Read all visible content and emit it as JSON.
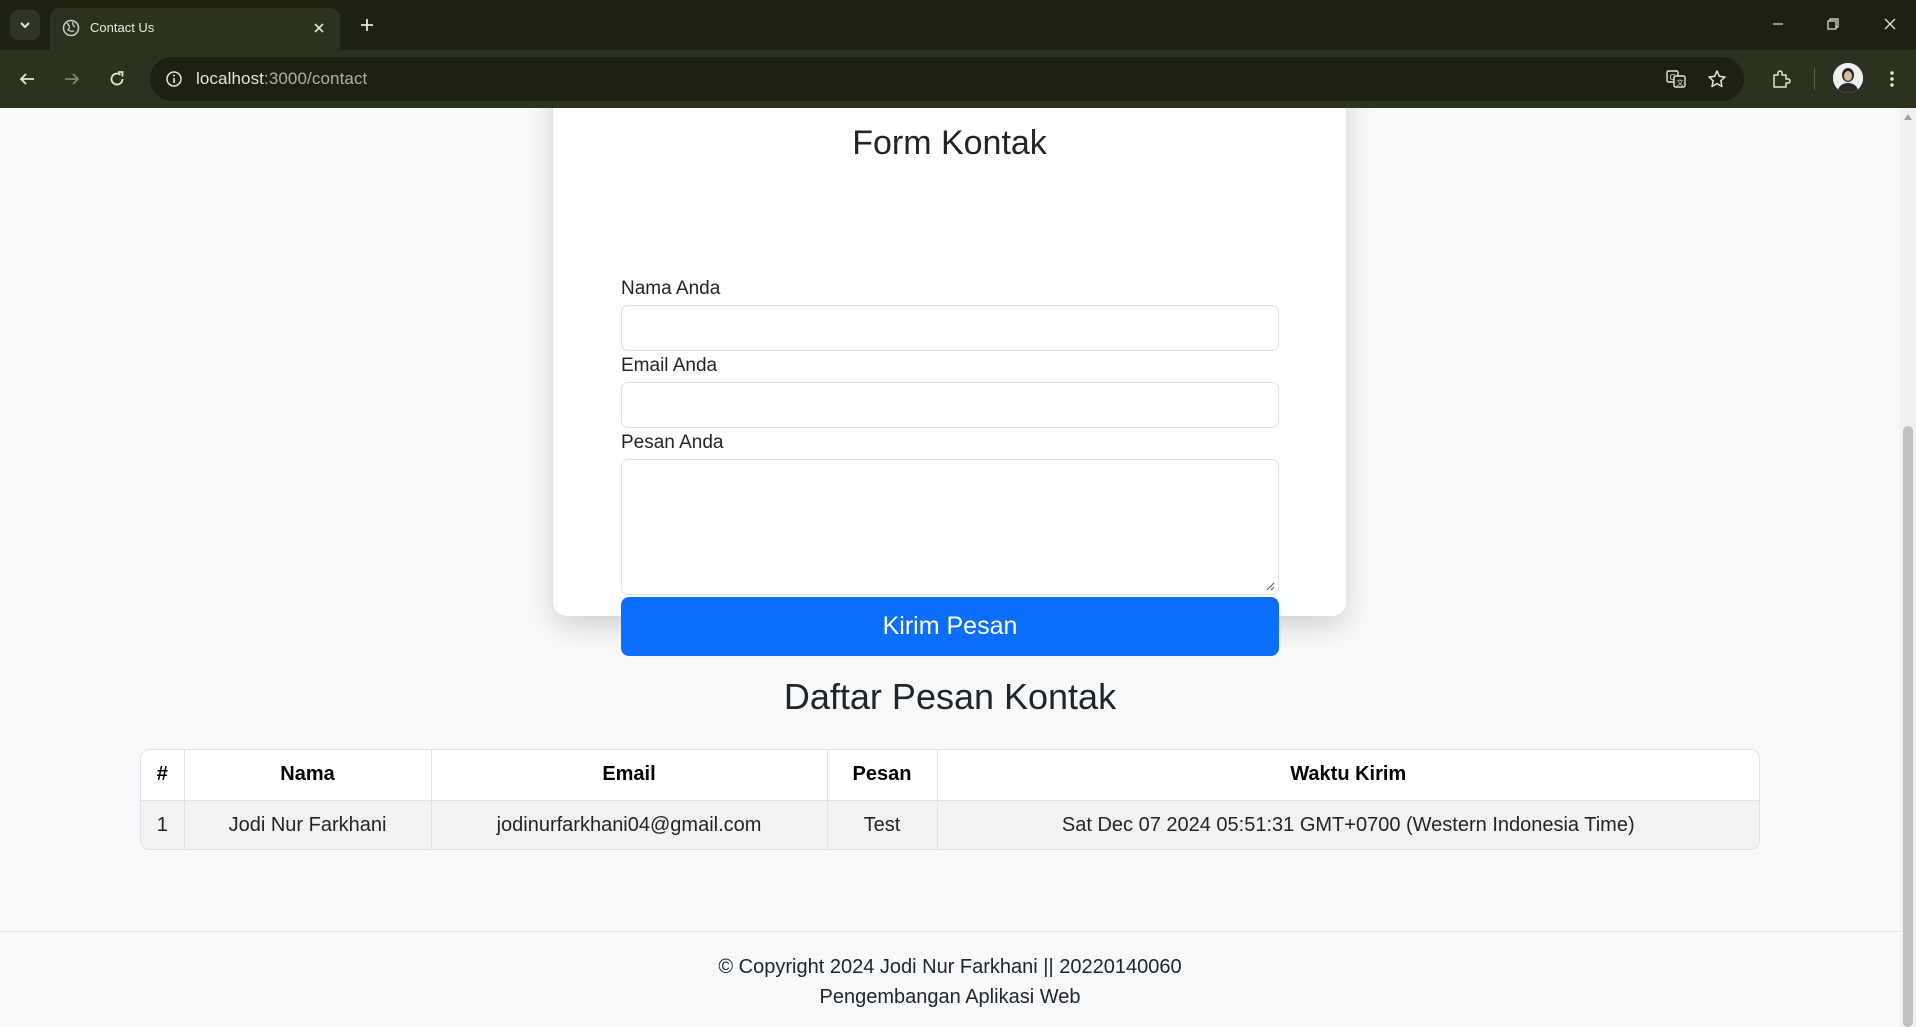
{
  "browser": {
    "tab_title": "Contact Us",
    "url_host": "localhost",
    "url_path": ":3000/contact",
    "icons": [
      "tab-search-icon",
      "globe-icon",
      "close-icon",
      "plus-icon",
      "minimize-icon",
      "restore-icon",
      "window-close-icon",
      "back-arrow-icon",
      "forward-arrow-icon",
      "reload-icon",
      "site-info-icon",
      "translate-icon",
      "star-icon",
      "extensions-icon",
      "avatar",
      "kebab-menu-icon"
    ]
  },
  "form": {
    "title": "Form Kontak",
    "name_label": "Nama Anda",
    "name_value": "",
    "email_label": "Email Anda",
    "email_value": "",
    "message_label": "Pesan Anda",
    "message_value": "",
    "submit_label": "Kirim Pesan"
  },
  "messages": {
    "title": "Daftar Pesan Kontak",
    "columns": [
      "#",
      "Nama",
      "Email",
      "Pesan",
      "Waktu Kirim"
    ],
    "rows": [
      [
        "1",
        "Jodi Nur Farkhani",
        "jodinurfarkhani04@gmail.com",
        "Test",
        "Sat Dec 07 2024 05:51:31 GMT+0700 (Western Indonesia Time)"
      ]
    ]
  },
  "footer": {
    "copyright": "© Copyright 2024 Jodi Nur Farkhani || 20220140060",
    "subtitle": "Pengembangan Aplikasi Web"
  },
  "colors": {
    "primary": "#0d6efd",
    "page_bg": "#f8f9fa",
    "chrome_dark": "#1c2113",
    "chrome_toolbar": "#2b3220"
  }
}
